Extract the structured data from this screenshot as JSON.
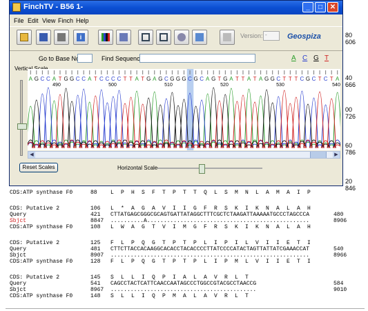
{
  "window": {
    "title": "FinchTV - B56 1-"
  },
  "menu": [
    "File",
    "Edit",
    "View",
    "Finch",
    "Help"
  ],
  "toolbar": {
    "version_label": "Version:",
    "version_value": "-",
    "brand": "Geospiza"
  },
  "search": {
    "go_to_base_label": "Go to Base No.",
    "go_to_base_value": "",
    "find_sequence_label": "Find Sequence",
    "find_sequence_value": ""
  },
  "bases": [
    {
      "letter": "A",
      "color": "#2a9d2a"
    },
    {
      "letter": "C",
      "color": "#2a3fcf"
    },
    {
      "letter": "G",
      "color": "#111111"
    },
    {
      "letter": "T",
      "color": "#d02020"
    }
  ],
  "vertical_scale_label": "Vertical Scale",
  "trace": {
    "sequence": "AGCCATGGCCATCCCCTTATGAGCGGGCGCAGTGATTATAGGCTTTCGCTCTA",
    "highlight_index": 27,
    "position_labels": [
      "490",
      "500",
      "510",
      "520",
      "530",
      "540"
    ]
  },
  "reset_scales": "Reset Scales",
  "horizontal_scale_label": "Horizontal Scale",
  "axis_numbers": [
    {
      "a": "80",
      "b": "606"
    },
    {
      "a": "40",
      "b": "666"
    },
    {
      "a": "00",
      "b": "726"
    },
    {
      "a": "60",
      "b": "786"
    },
    {
      "a": "20",
      "b": "846"
    }
  ],
  "alignment": {
    "top_line": {
      "label": "CDS:ATP synthase F0",
      "num": "88",
      "aa": "L  P  H  S  F  T  P  T  T  Q  L  S  M  N  L  A  M  A  I  P"
    },
    "blocks": [
      {
        "cds2": {
          "label": "CDS: Putative 2",
          "num": "106",
          "aa": "L  *  A  G  A  V  I  I  G  F  R  S  K  I  K  N  A  L  A  H"
        },
        "query": {
          "label": "Query",
          "start": "421",
          "seq": "CTTATGAGCGGGCGCAGTGATTATAGGCTTTCGCTCTAAGATTAAAAATGCCCTAGCCCA",
          "end": "480"
        },
        "sbjct": {
          "label": "Sbjct",
          "start": "8847",
          "seq": "..........A.................................................",
          "end": "8906"
        },
        "cds1": {
          "label": "CDS:ATP synthase F0",
          "num": "108",
          "aa": "L  W  A  G  T  V  I  M  G  F  R  S  K  I  K  N  A  L  A  H"
        }
      },
      {
        "cds2": {
          "label": "CDS: Putative 2",
          "num": "125",
          "aa": "F  L  P  Q  G  T  P  T  P  L  I  P  I  L  V  I  I  E  T  I"
        },
        "query": {
          "label": "Query",
          "start": "481",
          "seq": "CTTCTTACCACAAGGCACACCTACACCCCTTATCCCCATACTAGTTATTATCGAAACCAT",
          "end": "540"
        },
        "sbjct": {
          "label": "Sbjct",
          "start": "8907",
          "seq": "............................................................",
          "end": "8966"
        },
        "cds1": {
          "label": "CDS:ATP synthase F0",
          "num": "128",
          "aa": "F  L  P  Q  G  T  P  T  P  L  I  P  M  L  V  I  I  E  T  I"
        }
      },
      {
        "cds2": {
          "label": "CDS: Putative 2",
          "num": "145",
          "aa": "S  L  L  I  Q  P  I  A  L  A  V  R  L  T"
        },
        "query": {
          "label": "Query",
          "start": "541",
          "seq": "CAGCCTACTCATTCAACCAATAGCCCTGGCCGTACGCCTAACCG",
          "end": "584"
        },
        "sbjct": {
          "label": "Sbjct",
          "start": "8967",
          "seq": "............................................",
          "end": "9010"
        },
        "cds1": {
          "label": "CDS:ATP synthase F0",
          "num": "148",
          "aa": "S  L  L  I  Q  P  M  A  L  A  V  R  L  T"
        }
      }
    ]
  }
}
